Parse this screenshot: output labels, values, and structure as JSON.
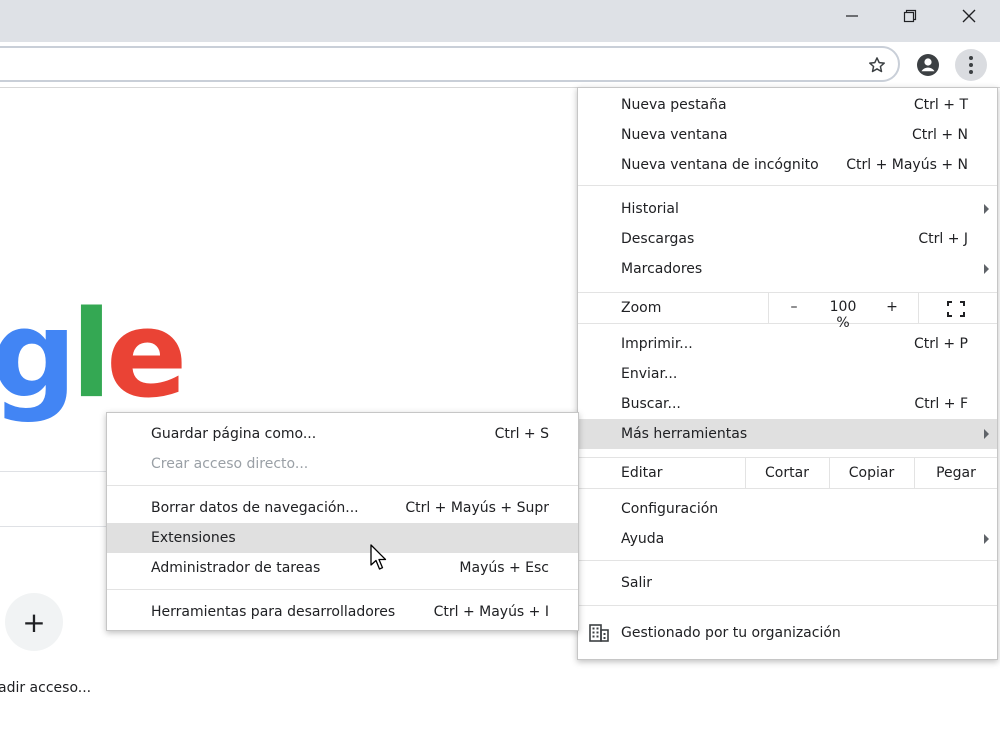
{
  "window": {
    "minimize_icon": "minimize-icon",
    "restore_icon": "restore-icon",
    "close_icon": "close-icon"
  },
  "toolbar": {
    "bookmark_icon": "star-icon",
    "profile_icon": "account-icon",
    "menu_icon": "kebab-menu-icon"
  },
  "page": {
    "logo_letters": [
      {
        "char": "g",
        "color": "#4285f4"
      },
      {
        "char": "l",
        "color": "#34a853"
      },
      {
        "char": "e",
        "color": "#ea4335"
      }
    ],
    "shortcut_add_symbol": "+",
    "shortcut_add_label": "adir acceso..."
  },
  "menu": {
    "new_tab": {
      "label": "Nueva pestaña",
      "shortcut": "Ctrl + T"
    },
    "new_window": {
      "label": "Nueva ventana",
      "shortcut": "Ctrl + N"
    },
    "incognito": {
      "label": "Nueva ventana de incógnito",
      "shortcut": "Ctrl + Mayús + N"
    },
    "history": {
      "label": "Historial"
    },
    "downloads": {
      "label": "Descargas",
      "shortcut": "Ctrl + J"
    },
    "bookmarks": {
      "label": "Marcadores"
    },
    "zoom": {
      "label": "Zoom",
      "minus": "–",
      "value": "100 %",
      "plus": "+"
    },
    "print": {
      "label": "Imprimir...",
      "shortcut": "Ctrl + P"
    },
    "cast": {
      "label": "Enviar..."
    },
    "find": {
      "label": "Buscar...",
      "shortcut": "Ctrl + F"
    },
    "more_tools": {
      "label": "Más herramientas"
    },
    "edit": {
      "label": "Editar",
      "cut": "Cortar",
      "copy": "Copiar",
      "paste": "Pegar"
    },
    "settings": {
      "label": "Configuración"
    },
    "help": {
      "label": "Ayuda"
    },
    "exit": {
      "label": "Salir"
    },
    "managed": {
      "label": "Gestionado por tu organización"
    }
  },
  "submenu": {
    "save_page": {
      "label": "Guardar página como...",
      "shortcut": "Ctrl + S"
    },
    "create_shortcut": {
      "label": "Crear acceso directo..."
    },
    "clear_data": {
      "label": "Borrar datos de navegación...",
      "shortcut": "Ctrl + Mayús + Supr"
    },
    "extensions": {
      "label": "Extensiones"
    },
    "task_manager": {
      "label": "Administrador de tareas",
      "shortcut": "Mayús + Esc"
    },
    "dev_tools": {
      "label": "Herramientas para desarrolladores",
      "shortcut": "Ctrl + Mayús + I"
    }
  }
}
